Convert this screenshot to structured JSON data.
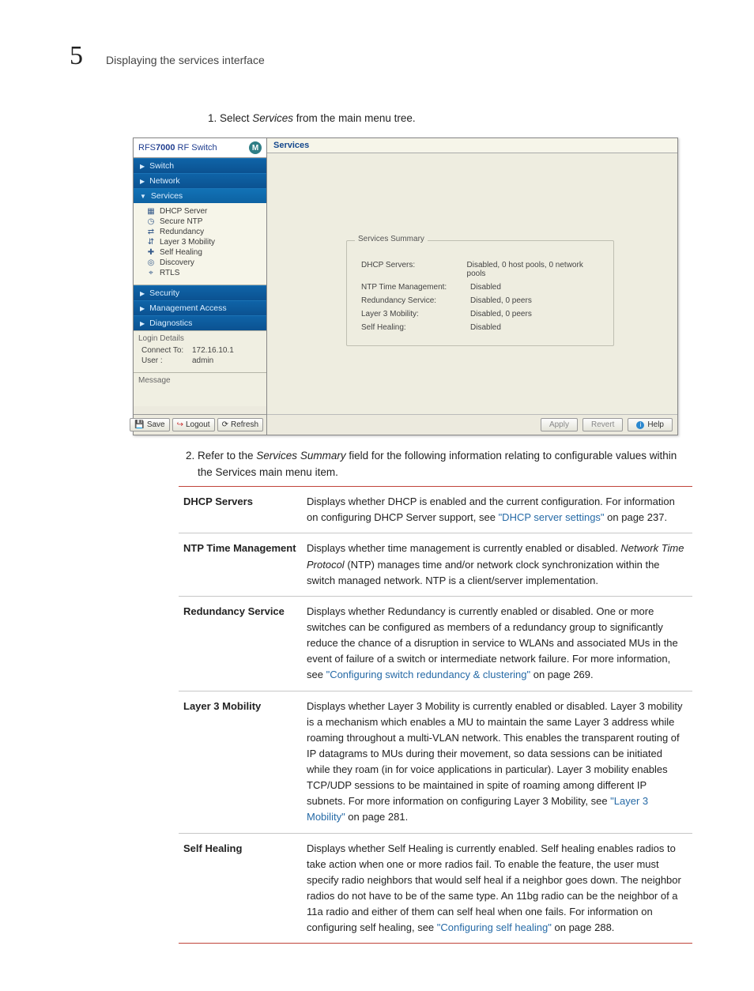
{
  "chapter_num": "5",
  "chapter_title": "Displaying the services interface",
  "step1_prefix": "Select ",
  "step1_em": "Services",
  "step1_suffix": " from the main menu tree.",
  "step2_prefix": "Refer to the ",
  "step2_em": "Services Summary",
  "step2_suffix": " field for the following information relating to configurable values within the Services main menu item.",
  "app": {
    "brand_html_prefix": "RFS",
    "brand_html_bold": "7000",
    "brand_html_suffix": " RF Switch",
    "logo": "M",
    "nav": {
      "switch": "Switch",
      "network": "Network",
      "services": "Services",
      "security": "Security",
      "mgmt": "Management Access",
      "diag": "Diagnostics"
    },
    "tree": {
      "dhcp": "DHCP Server",
      "ntp": "Secure NTP",
      "red": "Redundancy",
      "l3": "Layer 3 Mobility",
      "heal": "Self Healing",
      "disc": "Discovery",
      "rtls": "RTLS"
    },
    "login": {
      "title": "Login Details",
      "connect_l": "Connect To:",
      "connect_v": "172.16.10.1",
      "user_l": "User :",
      "user_v": "admin",
      "msg": "Message"
    },
    "btn_save": "Save",
    "btn_logout": "Logout",
    "btn_refresh": "Refresh",
    "main_title": "Services",
    "summary_title": "Services Summary",
    "rows": {
      "dhcp_k": "DHCP Servers:",
      "dhcp_v": "Disabled, 0 host pools, 0 network pools",
      "ntp_k": "NTP Time Management:",
      "ntp_v": "Disabled",
      "red_k": "Redundancy Service:",
      "red_v": "Disabled, 0 peers",
      "l3_k": "Layer 3 Mobility:",
      "l3_v": "Disabled, 0 peers",
      "heal_k": "Self Healing:",
      "heal_v": "Disabled"
    },
    "apply": "Apply",
    "revert": "Revert",
    "help": "Help"
  },
  "defs": {
    "dhcp_k": "DHCP Servers",
    "dhcp_v1": "Displays whether DHCP is enabled and the current configuration. For information on configuring DHCP Server support, see ",
    "dhcp_link": "\"DHCP server settings\"",
    "dhcp_v2": " on page 237.",
    "ntp_k": "NTP Time Management",
    "ntp_v1": "Displays whether time management is currently enabled or disabled. ",
    "ntp_em": "Network Time Protocol",
    "ntp_v2": " (NTP) manages time and/or network clock synchronization within the switch managed network. NTP is a client/server implementation.",
    "red_k": "Redundancy Service",
    "red_v1": "Displays whether Redundancy is currently enabled or disabled. One or more switches can be configured as members of a redundancy group to significantly reduce the chance of a disruption in service to WLANs and associated MUs in the event of failure of a switch or intermediate network failure. For more information, see ",
    "red_link": "\"Configuring switch redundancy & clustering\"",
    "red_v2": " on page 269.",
    "l3_k": "Layer 3 Mobility",
    "l3_v1": "Displays whether Layer 3 Mobility is currently enabled or disabled. Layer 3 mobility is a mechanism which enables a MU to maintain the same Layer 3 address while roaming throughout a multi-VLAN network. This enables the transparent routing of IP datagrams to MUs during their movement, so data sessions can be initiated while they roam (in for voice applications in particular). Layer 3 mobility enables TCP/UDP sessions to be maintained in spite of roaming among different IP subnets. For more information on configuring Layer 3 Mobility, see ",
    "l3_link": "\"Layer 3 Mobility\"",
    "l3_v2": " on page 281.",
    "heal_k": "Self Healing",
    "heal_v1": "Displays whether Self Healing is currently enabled. Self healing enables radios to take action when one or more radios fail. To enable the feature, the user must specify radio neighbors that would self heal if a neighbor goes down. The neighbor radios do not have to be of the same type. An 11bg radio can be the neighbor of a 11a radio and either of them can self heal when one fails. For information on configuring self healing, see ",
    "heal_link": "\"Configuring self healing\"",
    "heal_v2": " on page 288."
  }
}
